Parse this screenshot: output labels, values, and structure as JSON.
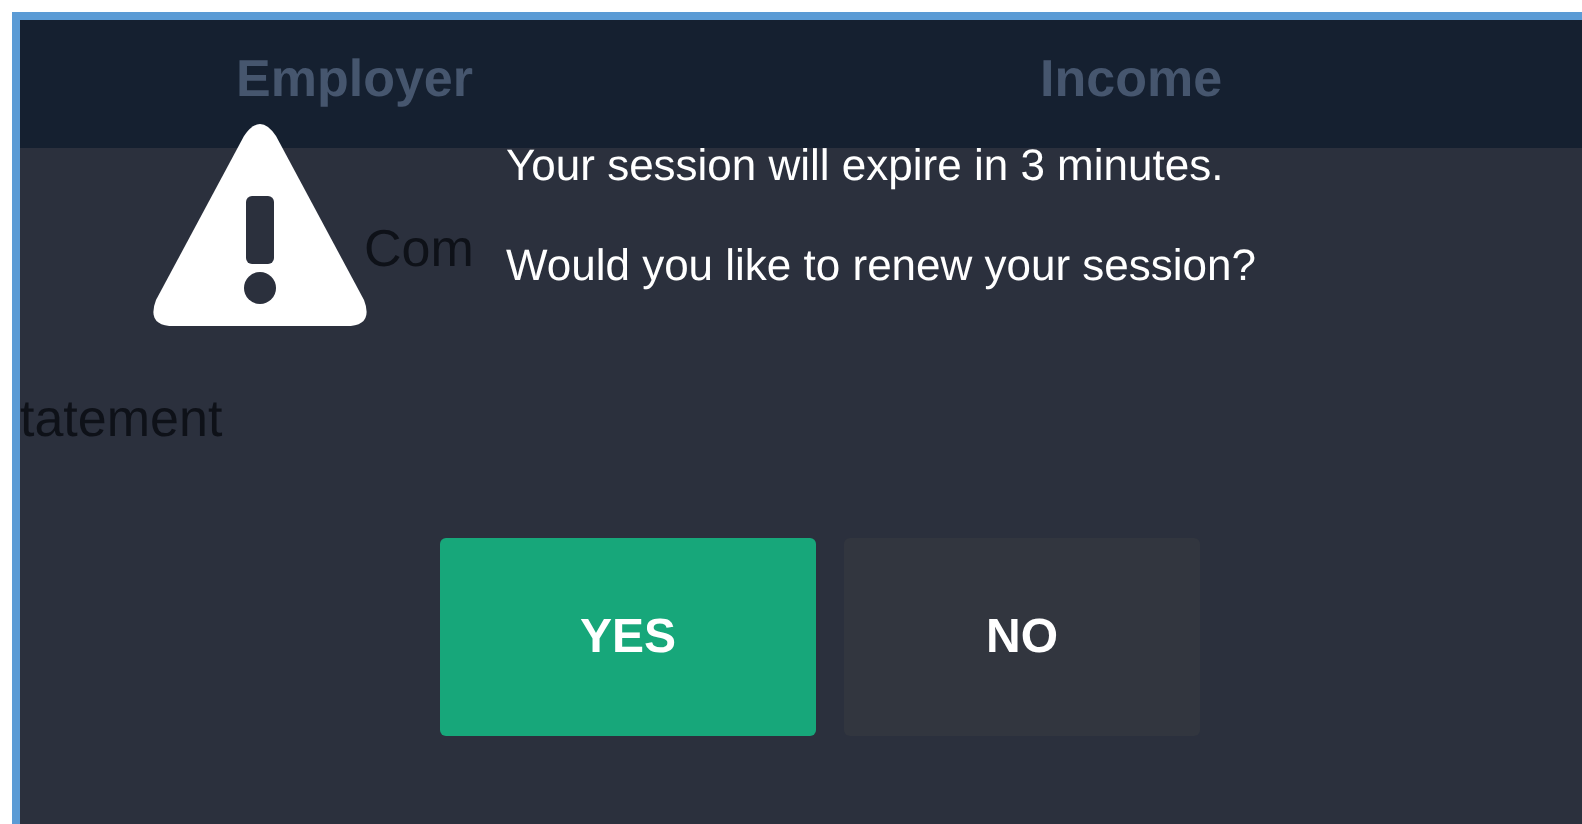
{
  "background": {
    "table_headers": [
      "Employer",
      "Income"
    ],
    "cell_fragment": "Com",
    "text_fragment": "tatement"
  },
  "dialog": {
    "message": "Your session will expire in 3 minutes. Would you like to renew your session?",
    "buttons": [
      {
        "label": "YES",
        "kind": "primary"
      },
      {
        "label": "NO",
        "kind": "secondary"
      }
    ]
  }
}
